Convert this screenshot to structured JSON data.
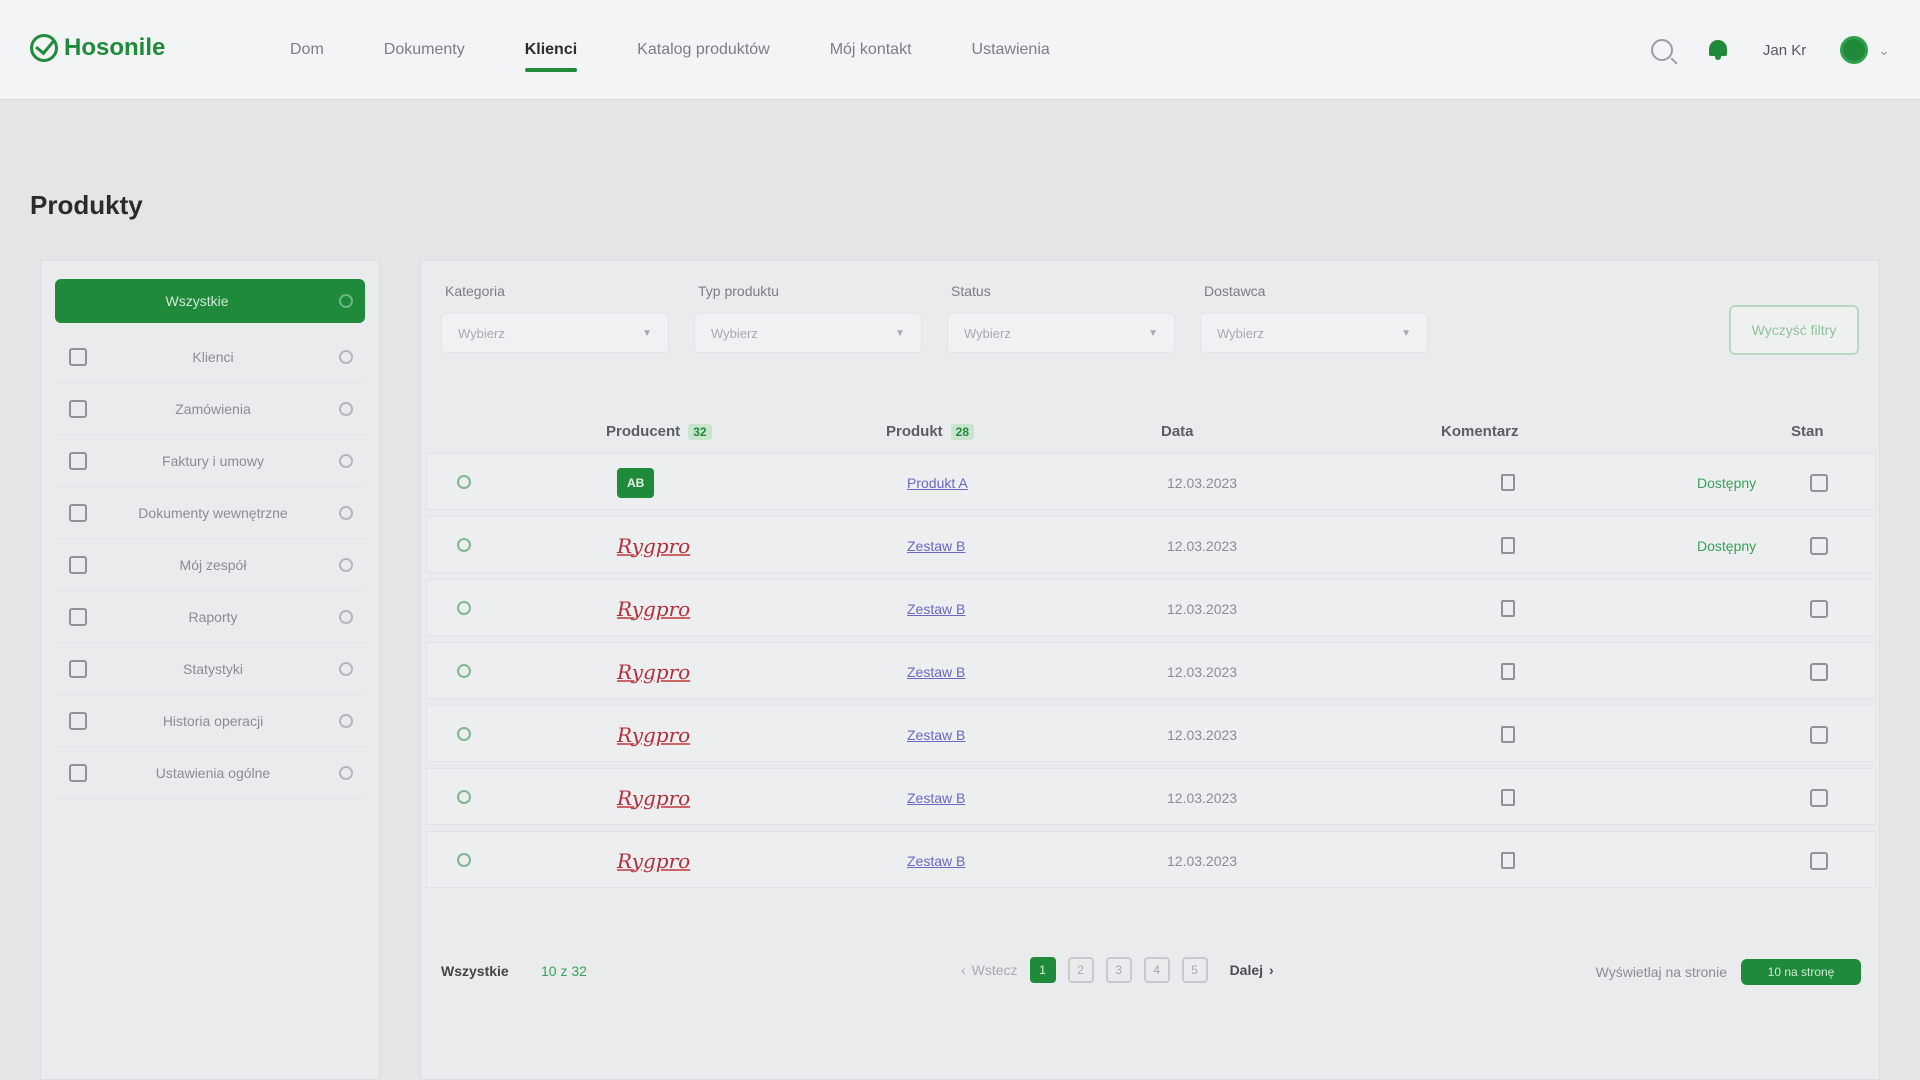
{
  "brand": {
    "logo_text": "Hosonile",
    "accent": "#1f8a3a"
  },
  "nav": {
    "items": [
      {
        "label": "Dom",
        "active": false
      },
      {
        "label": "Dokumenty",
        "active": false
      },
      {
        "label": "Klienci",
        "active": true
      },
      {
        "label": "Katalog produktów",
        "active": false
      },
      {
        "label": "Mój kontakt",
        "active": false
      },
      {
        "label": "Ustawienia",
        "active": false
      }
    ],
    "user_name": "Jan Kr"
  },
  "page": {
    "title": "Produkty"
  },
  "sidebar": {
    "items": [
      {
        "label": "Wszystkie",
        "active": true
      },
      {
        "label": "Klienci"
      },
      {
        "label": "Zamówienia"
      },
      {
        "label": "Faktury i umowy"
      },
      {
        "label": "Dokumenty wewnętrzne"
      },
      {
        "label": "Mój zespół"
      },
      {
        "label": "Raporty"
      },
      {
        "label": "Statystyki"
      },
      {
        "label": "Historia operacji"
      },
      {
        "label": "Ustawienia ogólne"
      }
    ]
  },
  "filters": [
    {
      "label": "Kategoria",
      "placeholder": "Wybierz"
    },
    {
      "label": "Typ produktu",
      "placeholder": "Wybierz"
    },
    {
      "label": "Status",
      "placeholder": "Wybierz"
    },
    {
      "label": "Dostawca",
      "placeholder": "Wybierz"
    }
  ],
  "clear_filters_label": "Wyczyść filtry",
  "table": {
    "headers": {
      "company": "Producent",
      "company_count": "32",
      "product": "Produkt",
      "product_count": "28",
      "date": "Data",
      "comment": "Komentarz",
      "status": "Stan"
    },
    "rows": [
      {
        "company_type": "badge",
        "company": "AB",
        "product": "Produkt A",
        "date": "12.03.2023",
        "status": "Dostępny"
      },
      {
        "company_type": "signature",
        "company": "Rygpro",
        "product": "Zestaw B",
        "date": "12.03.2023",
        "status": "Dostępny"
      },
      {
        "company_type": "signature",
        "company": "Rygpro",
        "product": "Zestaw B",
        "date": "12.03.2023",
        "status": ""
      },
      {
        "company_type": "signature",
        "company": "Rygpro",
        "product": "Zestaw B",
        "date": "12.03.2023",
        "status": ""
      },
      {
        "company_type": "signature",
        "company": "Rygpro",
        "product": "Zestaw B",
        "date": "12.03.2023",
        "status": ""
      },
      {
        "company_type": "signature",
        "company": "Rygpro",
        "product": "Zestaw B",
        "date": "12.03.2023",
        "status": ""
      },
      {
        "company_type": "signature",
        "company": "Rygpro",
        "product": "Zestaw B",
        "date": "12.03.2023",
        "status": ""
      }
    ]
  },
  "footer": {
    "total_label": "Wszystkie",
    "total_count": "10 z 32",
    "prev_label": "Wstecz",
    "pages": [
      "1",
      "2",
      "3",
      "4",
      "5"
    ],
    "next_label": "Dalej",
    "per_page_label": "Wyświetlaj na stronie",
    "per_page_value": "10 na stronę"
  }
}
